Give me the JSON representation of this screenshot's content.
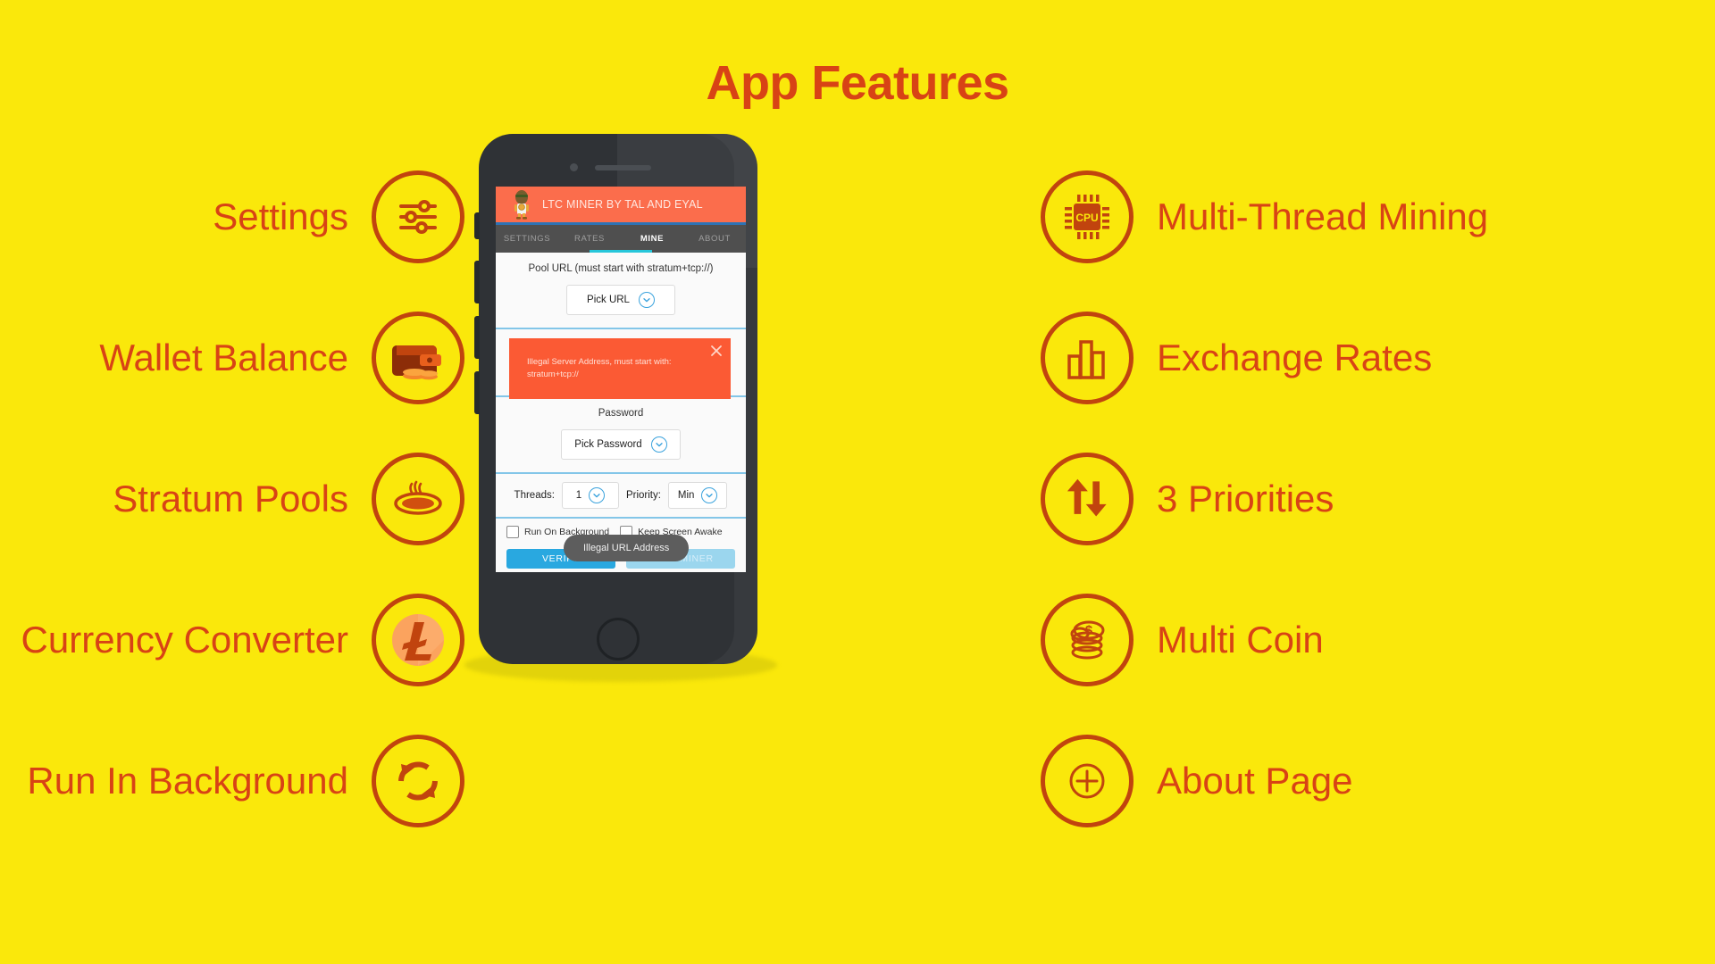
{
  "page": {
    "title": "App Features",
    "background_color": "#FAE80B",
    "accent_color": "#D84315"
  },
  "features_left": [
    {
      "label": "Settings",
      "icon": "sliders-icon"
    },
    {
      "label": "Wallet Balance",
      "icon": "wallet-icon"
    },
    {
      "label": "Stratum Pools",
      "icon": "pool-icon"
    },
    {
      "label": "Currency Converter",
      "icon": "litecoin-icon"
    },
    {
      "label": "Run In Background",
      "icon": "refresh-cycle-icon"
    }
  ],
  "features_right": [
    {
      "label": "Multi-Thread Mining",
      "icon": "cpu-icon"
    },
    {
      "label": "Exchange Rates",
      "icon": "bar-chart-icon"
    },
    {
      "label": "3 Priorities",
      "icon": "up-down-arrows-icon"
    },
    {
      "label": "Multi Coin",
      "icon": "coin-stack-icon"
    },
    {
      "label": "About Page",
      "icon": "plus-circle-icon"
    }
  ],
  "phone": {
    "app_bar": {
      "title": "LTC MINER BY TAL AND EYAL",
      "background_color": "#FB6D4C",
      "mascot_icon": "miner-mascot-icon"
    },
    "tabs": [
      {
        "label": "SETTINGS",
        "active": false
      },
      {
        "label": "RATES",
        "active": false
      },
      {
        "label": "MINE",
        "active": true
      },
      {
        "label": "ABOUT",
        "active": false
      }
    ],
    "pool_url_section": {
      "label": "Pool URL (must start with stratum+tcp://)",
      "picker_value": "Pick URL",
      "chevron_icon": "chevron-down-circle-icon"
    },
    "error_banner": {
      "message": "Illegal Server Address, must start with: stratum+tcp://",
      "background_color": "#FB5A34",
      "close_icon": "close-icon"
    },
    "password_section": {
      "label": "Password",
      "picker_value": "Pick Password",
      "chevron_icon": "chevron-down-circle-icon"
    },
    "threads_row": {
      "threads_label": "Threads:",
      "threads_value": "1",
      "priority_label": "Priority:",
      "priority_value": "Min",
      "chevron_icon": "chevron-down-circle-icon"
    },
    "checkboxes": [
      {
        "label": "Run On Background",
        "checked": false
      },
      {
        "label": "Keep Screen Awake",
        "checked": false
      }
    ],
    "toast": {
      "message": "Illegal URL Address"
    },
    "buttons": {
      "verify": "VERIFY",
      "open_miner": "OPEN MINER",
      "verify_color": "#29A8E0",
      "open_miner_color": "#9BD6EE"
    }
  }
}
